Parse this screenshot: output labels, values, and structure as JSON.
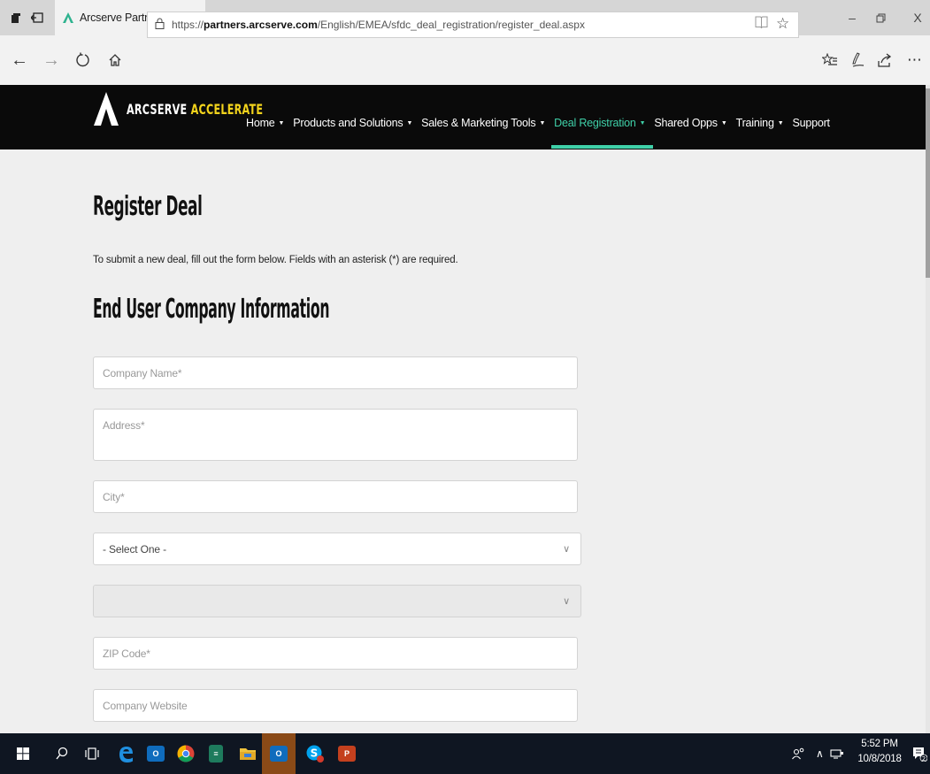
{
  "browser": {
    "tab_title": "Arcserve Partner Portal",
    "tab_close_glyph": "X",
    "new_tab_glyph": "+",
    "tab_list_glyph": "∨",
    "url_prefix": "https://",
    "url_domain": "partners.arcserve.com",
    "url_path": "/English/EMEA/sfdc_deal_registration/register_deal.aspx",
    "icons": [
      "tabs-aside-icon",
      "set-tabs-aside-icon",
      "back-icon",
      "forward-icon",
      "refresh-icon",
      "home-icon",
      "lock-icon",
      "reading-view-icon",
      "favorite-star-icon",
      "favorites-hub-icon",
      "notes-pen-icon",
      "share-icon",
      "more-icon",
      "minimize-icon",
      "restore-icon",
      "close-window-icon"
    ]
  },
  "header": {
    "brand_main": "ARCSERVE ",
    "brand_accent": "ACCELERATE",
    "accent_color": "#3fd0a8",
    "brand_accent_color": "#f2d31c",
    "nav": [
      {
        "label": "Home",
        "dropdown": true,
        "active": false
      },
      {
        "label": "Products and Solutions",
        "dropdown": true,
        "active": false
      },
      {
        "label": "Sales & Marketing Tools",
        "dropdown": true,
        "active": false
      },
      {
        "label": "Deal Registration",
        "dropdown": true,
        "active": true
      },
      {
        "label": "Shared Opps",
        "dropdown": true,
        "active": false
      },
      {
        "label": "Training",
        "dropdown": true,
        "active": false
      },
      {
        "label": "Support",
        "dropdown": false,
        "active": false
      }
    ]
  },
  "main": {
    "title": "Register Deal",
    "intro": "To submit a new deal, fill out the form below. Fields with an asterisk (*) are required.",
    "section_title": "End User Company Information",
    "fields": {
      "company_name": {
        "placeholder": "Company Name*"
      },
      "address": {
        "placeholder": "Address*"
      },
      "city": {
        "placeholder": "City*"
      },
      "country": {
        "value": "- Select One -"
      },
      "state": {
        "value": "",
        "disabled": true
      },
      "zip": {
        "placeholder": "ZIP Code*"
      },
      "website": {
        "placeholder": "Company Website"
      }
    }
  },
  "taskbar": {
    "apps": [
      "windows-start-icon",
      "cortana-search-icon",
      "task-view-icon",
      "edge-icon",
      "outlook-icon",
      "chrome-icon",
      "calculator-icon",
      "file-explorer-icon",
      "outlook-ins-icon",
      "skype-icon",
      "powerpoint-icon"
    ],
    "time": "5:52 PM",
    "date": "10/8/2018",
    "notification_count": "2"
  }
}
